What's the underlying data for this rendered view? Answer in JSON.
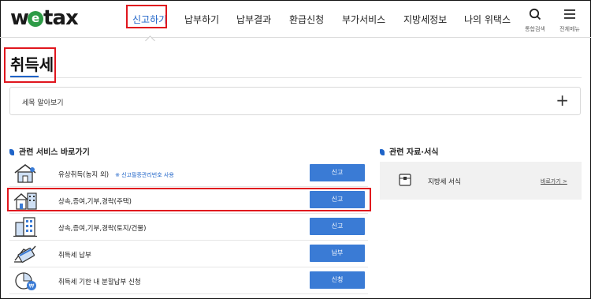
{
  "header": {
    "logo_prefix": "w",
    "logo_e": "e",
    "logo_suffix": "tax",
    "nav": [
      {
        "label": "신고하기",
        "active": true
      },
      {
        "label": "납부하기",
        "active": false
      },
      {
        "label": "납부결과",
        "active": false
      },
      {
        "label": "환급신청",
        "active": false
      },
      {
        "label": "부가서비스",
        "active": false
      },
      {
        "label": "지방세정보",
        "active": false
      },
      {
        "label": "나의 위택스",
        "active": false
      }
    ],
    "search_label": "통합검색",
    "menu_label": "전체메뉴",
    "search_icon": "search-icon",
    "menu_icon": "hamburger-menu-icon"
  },
  "page": {
    "title": "취득세",
    "accordion_label": "세목 알아보기",
    "accordion_icon": "plus-icon"
  },
  "services": {
    "section_title": "관련 서비스 바로가기",
    "items": [
      {
        "icon": "house-icon",
        "name": "유상취득(농지 외)",
        "note": "※ 신고필증관리번호 사용",
        "button": "신고"
      },
      {
        "icon": "house-building-icon",
        "name": "상속,증여,기부,경락(주택)",
        "note": "",
        "button": "신고"
      },
      {
        "icon": "building-icon",
        "name": "상속,증여,기부,경락(토지/건물)",
        "note": "",
        "button": "신고"
      },
      {
        "icon": "card-payment-icon",
        "name": "취득세 납부",
        "note": "",
        "button": "납부"
      },
      {
        "icon": "installment-chart-icon",
        "name": "취득세 기한 내 분할납부 신청",
        "note": "",
        "button": "신청"
      }
    ]
  },
  "documents": {
    "section_title": "관련 자료·서식",
    "item_name": "지방세 서식",
    "item_link": "바로가기 >",
    "item_icon": "document-box-icon"
  },
  "colors": {
    "accent": "#1f64c8",
    "button": "#3a7bd5",
    "annotation": "#e0161e",
    "logo_e": "#2d9b46"
  }
}
